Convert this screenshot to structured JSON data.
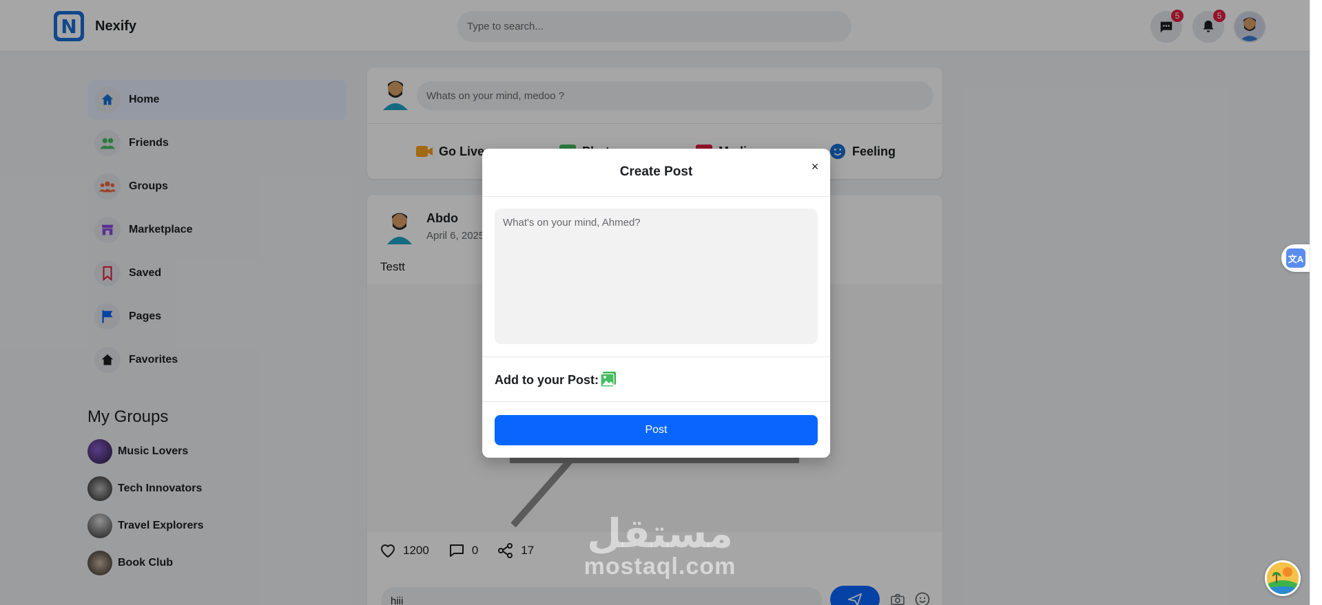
{
  "header": {
    "logo_letter": "N",
    "brand": "Nexify",
    "search_placeholder": "Type to search...",
    "messages_badge": "5",
    "notifications_badge": "5"
  },
  "sidebar": {
    "items": [
      {
        "label": "Home",
        "icon": "home-icon",
        "color": "#1a6fd6"
      },
      {
        "label": "Friends",
        "icon": "friends-icon",
        "color": "#45bd62"
      },
      {
        "label": "Groups",
        "icon": "groups-icon",
        "color": "#f0643c"
      },
      {
        "label": "Marketplace",
        "icon": "marketplace-icon",
        "color": "#8a4be0"
      },
      {
        "label": "Saved",
        "icon": "saved-icon",
        "color": "#e41e3f"
      },
      {
        "label": "Pages",
        "icon": "pages-icon",
        "color": "#0866ff"
      },
      {
        "label": "Favorites",
        "icon": "favorites-icon",
        "color": "#1c1e21"
      }
    ],
    "groups_title": "My Groups",
    "groups": [
      {
        "label": "Music Lovers"
      },
      {
        "label": "Tech Innovators"
      },
      {
        "label": "Travel Explorers"
      },
      {
        "label": "Book Club"
      }
    ]
  },
  "composer": {
    "placeholder": "Whats on your mind, medoo ?",
    "actions": [
      {
        "label": "Go Live",
        "icon": "video-icon",
        "color": "#f7a21c"
      },
      {
        "label": "Photo",
        "icon": "photo-icon",
        "color": "#45bd62"
      },
      {
        "label": "Media",
        "icon": "media-icon",
        "color": "#e41e3f"
      },
      {
        "label": "Feeling",
        "icon": "feeling-icon",
        "color": "#1a6fd6"
      }
    ]
  },
  "post": {
    "author": "Abdo",
    "date": "April 6, 2025",
    "text": "Testt",
    "likes": "1200",
    "comments": "0",
    "shares": "17",
    "reply_value": "hiii"
  },
  "modal": {
    "title": "Create Post",
    "close": "×",
    "textarea_placeholder": "What's on your mind, Ahmed?",
    "add_label": "Add to your Post:",
    "post_button": "Post"
  },
  "watermark": {
    "arabic": "مستقل",
    "latin": "mostaql.com"
  },
  "translate_label": "文A",
  "colors": {
    "accent": "#0866ff",
    "overlay": "rgba(0,0,0,0.35)"
  }
}
